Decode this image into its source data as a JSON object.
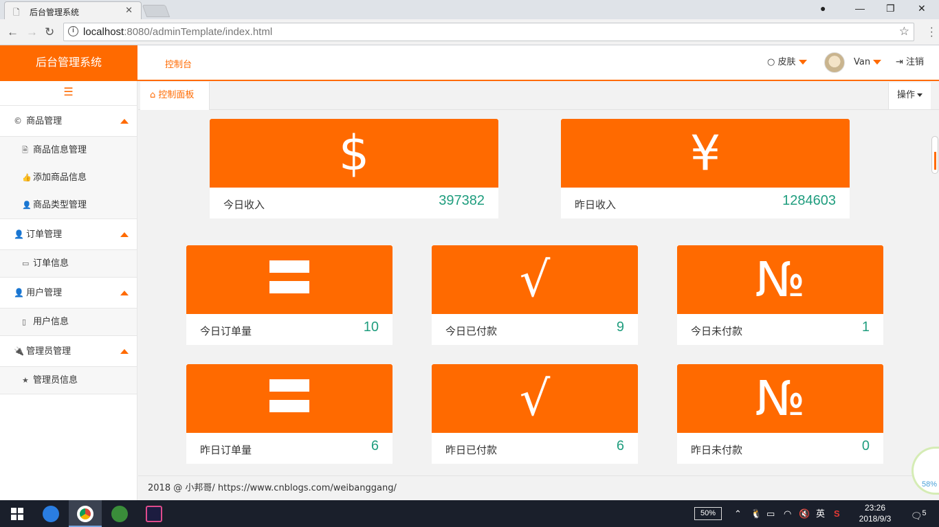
{
  "browser": {
    "tab_title": "后台管理系统",
    "url_host": "localhost",
    "url_rest": ":8080/adminTemplate/index.html"
  },
  "header": {
    "logo": "后台管理系统",
    "nav_item": "控制台",
    "skin_label": "皮肤",
    "user_name": "Van",
    "logout_label": "注销"
  },
  "sidebar": {
    "groups": [
      {
        "label": "商品管理",
        "icon": "copyright-icon",
        "items": [
          "商品信息管理",
          "添加商品信息",
          "商品类型管理"
        ]
      },
      {
        "label": "订单管理",
        "icon": "user-icon",
        "items": [
          "订单信息"
        ]
      },
      {
        "label": "用户管理",
        "icon": "user-icon",
        "items": [
          "用户信息"
        ]
      },
      {
        "label": "管理员管理",
        "icon": "plug-icon",
        "items": [
          "管理员信息"
        ]
      }
    ]
  },
  "tabs": {
    "active_tab": "控制面板",
    "ops_label": "操作"
  },
  "cards": {
    "today_income": {
      "symbol": "$",
      "label": "今日收入",
      "value": "397382"
    },
    "yesterday_income": {
      "symbol": "¥",
      "label": "昨日收入",
      "value": "1284603"
    },
    "today_orders": {
      "label": "今日订单量",
      "value": "10"
    },
    "today_paid": {
      "symbol": "√",
      "label": "今日已付款",
      "value": "9"
    },
    "today_unpaid": {
      "symbol": "№",
      "label": "今日未付款",
      "value": "1"
    },
    "yesterday_orders": {
      "label": "昨日订单量",
      "value": "6"
    },
    "yesterday_paid": {
      "symbol": "√",
      "label": "昨日已付款",
      "value": "6"
    },
    "yesterday_unpaid": {
      "symbol": "№",
      "label": "昨日未付款",
      "value": "0"
    }
  },
  "footer": {
    "text": "2018 @ 小邦哥/ https://www.cnblogs.com/weibanggang/"
  },
  "gauge": {
    "value": "58%"
  },
  "taskbar": {
    "battery": "50%",
    "ime": "英",
    "time": "23:26",
    "date": "2018/9/3",
    "notifications": "5"
  },
  "colors": {
    "accent": "#ff6a00",
    "value_text": "#1f9d7e"
  }
}
